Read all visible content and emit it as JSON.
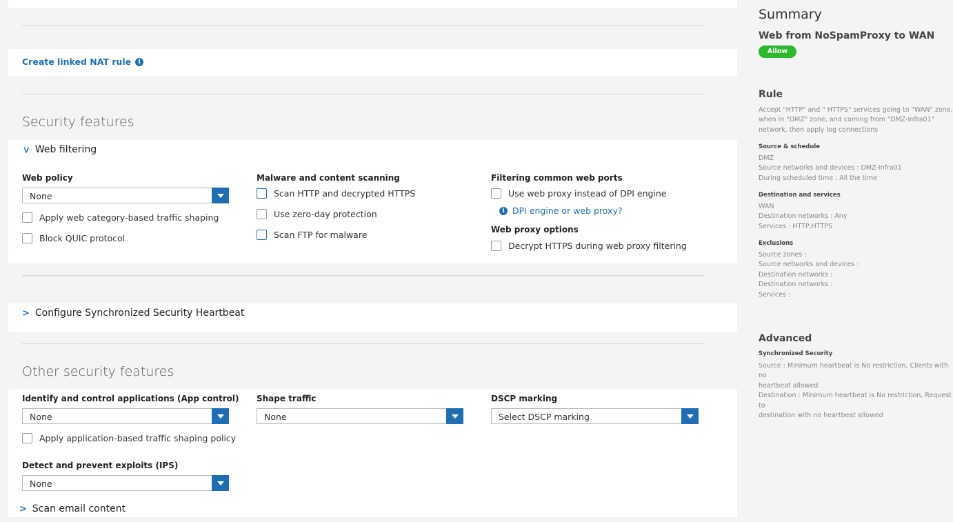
{
  "nat": {
    "link_label": "Create linked NAT rule"
  },
  "security": {
    "title": "Security features",
    "web_filtering": {
      "label": "Web filtering",
      "web_policy": {
        "label": "Web policy",
        "value": "None",
        "apply_shaping": "Apply web category-based traffic shaping",
        "block_quic": "Block QUIC protocol"
      },
      "malware": {
        "label": "Malware and content scanning",
        "scan_http": "Scan HTTP and decrypted HTTPS",
        "zero_day": "Use zero-day protection",
        "scan_ftp": "Scan FTP for malware"
      },
      "ports": {
        "label": "Filtering common web ports",
        "use_proxy": "Use web proxy instead of DPI engine",
        "dpi_link": "DPI engine or web proxy?",
        "proxy_options_label": "Web proxy options",
        "decrypt_https": "Decrypt HTTPS during web proxy filtering"
      }
    },
    "heartbeat_label": "Configure Synchronized Security Heartbeat"
  },
  "other": {
    "title": "Other security features",
    "app_control": {
      "label": "Identify and control applications (App control)",
      "value": "None",
      "apply_policy": "Apply application-based traffic shaping policy"
    },
    "shape": {
      "label": "Shape traffic",
      "value": "None"
    },
    "dscp": {
      "label": "DSCP marking",
      "value": "Select DSCP marking"
    },
    "ips": {
      "label": "Detect and prevent exploits (IPS)",
      "value": "None"
    },
    "email_label": "Scan email content"
  },
  "summary": {
    "title": "Summary",
    "rule_name": "Web from NoSpamProxy to WAN",
    "action_badge": "Allow",
    "rule_heading": "Rule",
    "rule_desc": [
      "Accept \"HTTP\" and \" HTTPS\" services going to \"WAN\" zone,",
      "when in \"DMZ\" zone, and coming from \"DMZ-Infra01\"",
      "network, then apply log connections"
    ],
    "source_heading": "Source & schedule",
    "source_lines": [
      "DMZ",
      "Source networks and devices : DMZ-Infra01",
      "During scheduled time : All the time"
    ],
    "dest_heading": "Destination and services",
    "dest_lines": [
      "WAN",
      "Destination networks : Any",
      "Services : HTTP,HTTPS"
    ],
    "excl_heading": "Exclusions",
    "excl_lines": [
      "Source zones :",
      "Source networks and devices :",
      "Destination networks :",
      "Destination networks :",
      "Services :"
    ],
    "advanced_heading": "Advanced",
    "sync_heading": "Synchronized Security",
    "sync_lines": [
      "Source : Minimum heartbeat is No restriction, Clients with no",
      "heartbeat allowed",
      "Destination : Minimum heartbeat is No restriction, Request to",
      "destination with no heartbeat allowed"
    ]
  },
  "colors": {
    "accent": "#1f6eb5",
    "allow_badge": "#2db82d"
  }
}
